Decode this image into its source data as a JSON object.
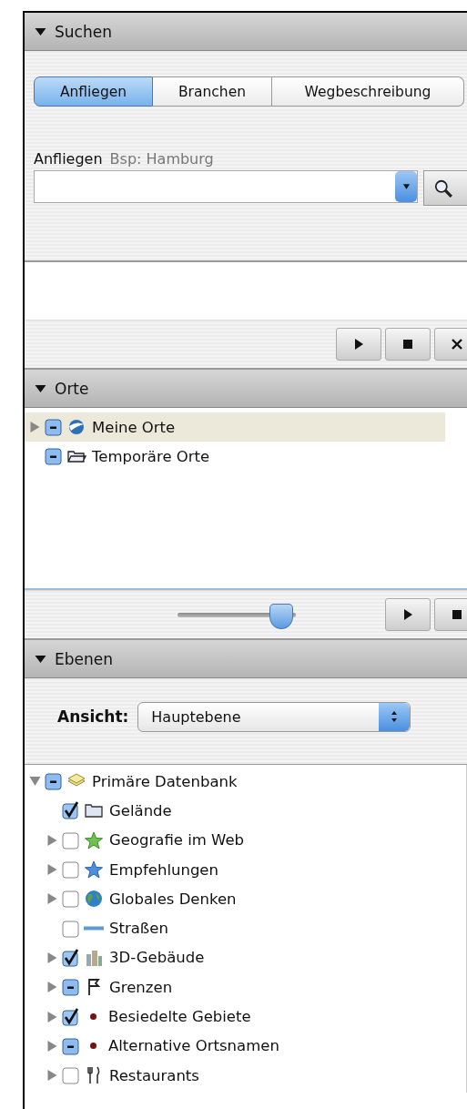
{
  "search_panel": {
    "title": "Suchen",
    "expanded": true,
    "tabs": [
      {
        "label": "Anfliegen",
        "selected": true
      },
      {
        "label": "Branchen",
        "selected": false
      },
      {
        "label": "Wegbeschreibung",
        "selected": false
      }
    ],
    "field_label": "Anfliegen",
    "field_hint": "Bsp: Hamburg"
  },
  "places_panel": {
    "title": "Orte",
    "expanded": true,
    "items": [
      {
        "label": "Meine Orte",
        "has_children": true,
        "expanded": false,
        "mixed": true,
        "selected": true
      },
      {
        "label": "Temporäre Orte",
        "has_children": false,
        "mixed": true,
        "selected": false
      }
    ],
    "slider": {
      "level": 0.88
    }
  },
  "layers_panel": {
    "title": "Ebenen",
    "expanded": true,
    "view_label": "Ansicht:",
    "view_value": "Hauptebene",
    "items": [
      {
        "label": "Primäre Datenbank",
        "has_children": true,
        "expanded": true,
        "mixed": true,
        "children": [
          {
            "label": "Gelände",
            "has_children": false,
            "checked": true,
            "mixed": false
          },
          {
            "label": "Geografie im Web",
            "has_children": true,
            "expanded": false,
            "checked": false,
            "mixed": false
          },
          {
            "label": "Empfehlungen",
            "has_children": true,
            "expanded": false,
            "checked": false,
            "mixed": false
          },
          {
            "label": "Globales Denken",
            "has_children": true,
            "expanded": false,
            "checked": false,
            "mixed": false
          },
          {
            "label": "Straßen",
            "has_children": false,
            "checked": false,
            "mixed": false
          },
          {
            "label": "3D-Gebäude",
            "has_children": true,
            "expanded": false,
            "checked": true,
            "mixed": false
          },
          {
            "label": "Grenzen",
            "has_children": true,
            "expanded": false,
            "mixed": true
          },
          {
            "label": "Besiedelte Gebiete",
            "has_children": true,
            "expanded": false,
            "checked": true,
            "mixed": false
          },
          {
            "label": "Alternative Ortsnamen",
            "has_children": true,
            "expanded": false,
            "mixed": true
          },
          {
            "label": "Restaurants",
            "has_children": true,
            "expanded": false,
            "checked": false,
            "mixed": false
          }
        ]
      }
    ]
  }
}
